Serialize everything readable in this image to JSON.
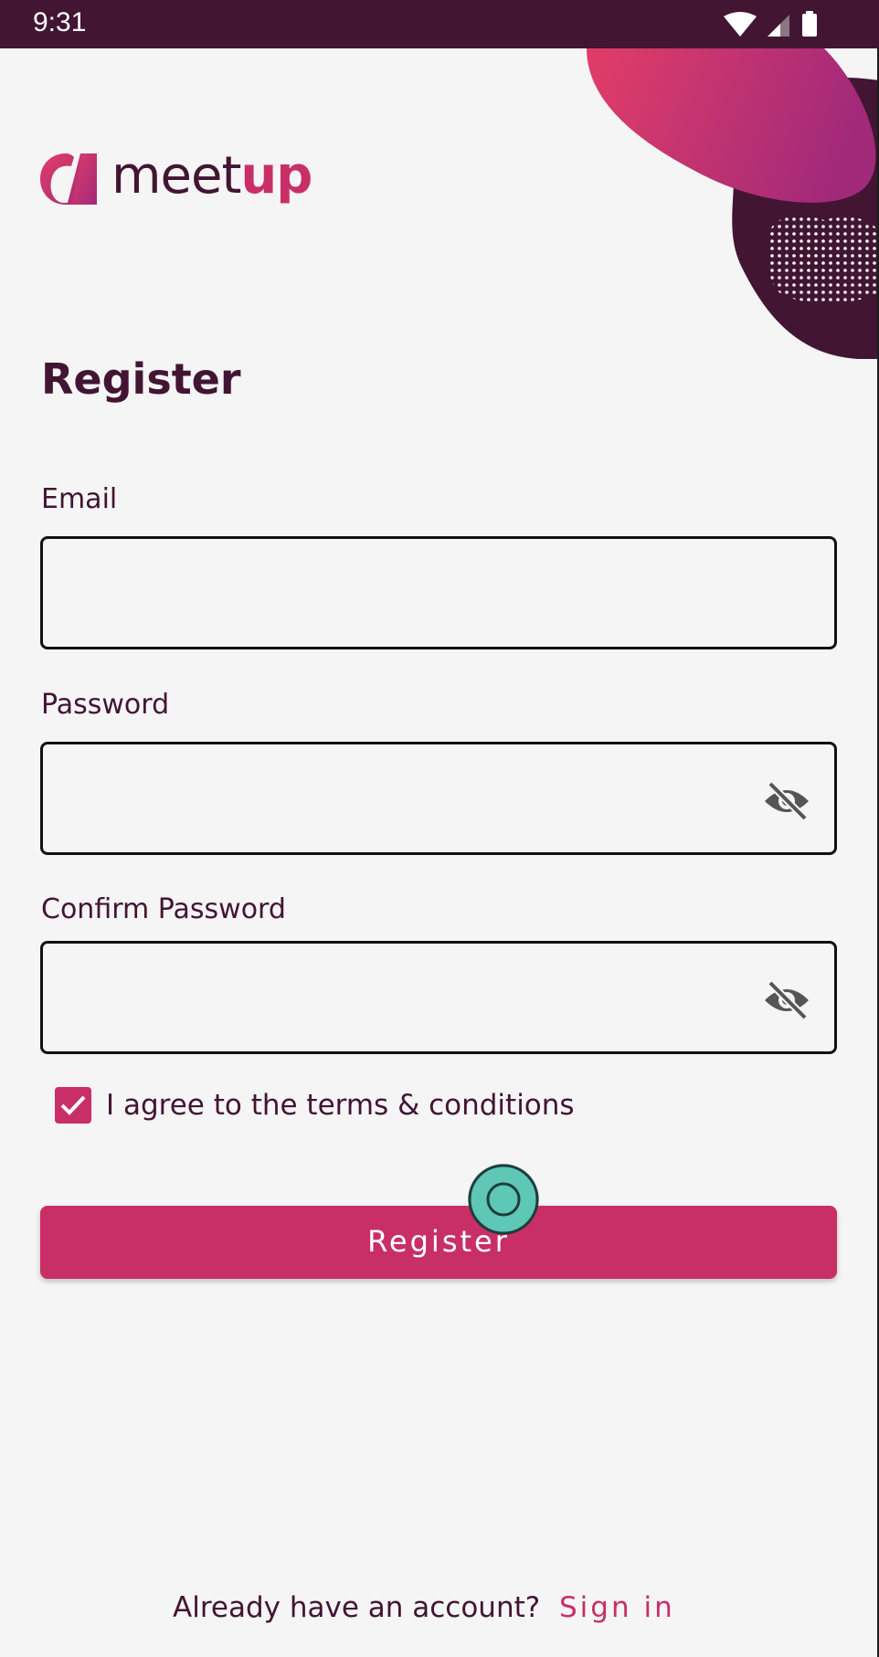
{
  "status_bar": {
    "time": "9:31",
    "icons": [
      "wifi-icon",
      "cellular-signal-icon",
      "battery-icon"
    ]
  },
  "logo": {
    "text_main": "meet",
    "text_accent": "up"
  },
  "page": {
    "title": "Register"
  },
  "form": {
    "email": {
      "label": "Email",
      "value": "",
      "placeholder": ""
    },
    "password": {
      "label": "Password",
      "value": "",
      "placeholder": "",
      "toggle_icon": "eye-off-icon"
    },
    "confirm_password": {
      "label": "Confirm Password",
      "value": "",
      "placeholder": "",
      "toggle_icon": "eye-off-icon"
    },
    "terms": {
      "label": "I agree to the terms & conditions",
      "checked": true
    },
    "submit_label": "Register"
  },
  "footer": {
    "prompt": "Already have an account?",
    "link": "Sign in"
  },
  "colors": {
    "brand_dark": "#421533",
    "accent": "#c92f67",
    "background": "#f5f5f5",
    "touch_indicator": "#5ec7b5"
  }
}
